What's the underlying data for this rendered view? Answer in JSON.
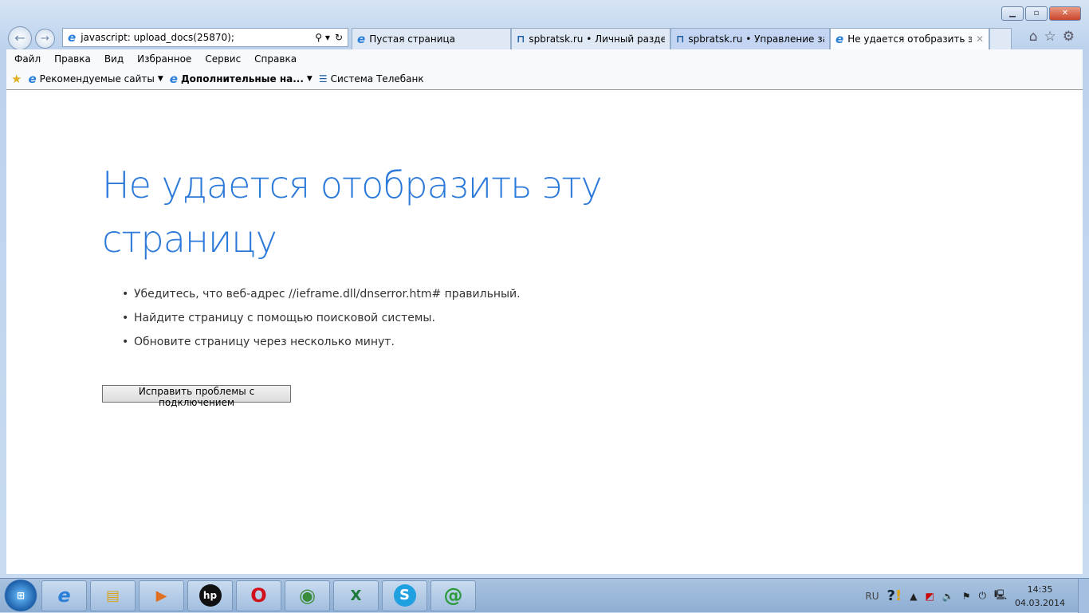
{
  "address": {
    "url": "javascript: upload_docs(25870);"
  },
  "tabs": [
    {
      "label": "Пустая страница",
      "icon": "ie-icon"
    },
    {
      "label": "spbratsk.ru • Личный раздел ...",
      "icon": "spbratsk-icon"
    },
    {
      "label": "spbratsk.ru • Управление заку...",
      "icon": "spbratsk-icon"
    },
    {
      "label": "Не удается отобразить эту...",
      "icon": "ie-icon",
      "active": true
    }
  ],
  "menu": [
    "Файл",
    "Правка",
    "Вид",
    "Избранное",
    "Сервис",
    "Справка"
  ],
  "favorites": [
    "Рекомендуемые сайты",
    "Дополнительные на...",
    "Система Телебанк"
  ],
  "page": {
    "title": "Не удается отобразить эту страницу",
    "bullets": [
      "Убедитесь, что веб-адрес //ieframe.dll/dnserror.htm# правильный.",
      "Найдите страницу с помощью поисковой системы.",
      "Обновите страницу через несколько минут."
    ],
    "fix_button": "Исправить проблемы с подключением"
  },
  "taskbar": {
    "lang": "RU",
    "time": "14:35",
    "date": "04.03.2014"
  }
}
